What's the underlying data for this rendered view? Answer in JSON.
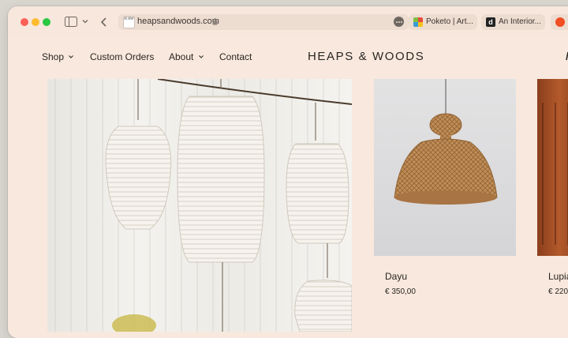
{
  "browser": {
    "url": "heapsandwoods.com",
    "favicon_text": "H AW",
    "tabs": [
      {
        "title": "Poketo | Art..."
      },
      {
        "title": "An Interior..."
      },
      {
        "title": ""
      }
    ]
  },
  "nav": {
    "shop": "Shop",
    "custom_orders": "Custom Orders",
    "about": "About",
    "contact": "Contact"
  },
  "logo": "HEAPS & WOODS",
  "products": [
    {
      "name": "Dayu",
      "price": "€ 350,00"
    },
    {
      "name": "Lupia",
      "price": "€ 220"
    }
  ],
  "colors": {
    "page_background": "#f8e8dd",
    "text": "#2a2623"
  }
}
